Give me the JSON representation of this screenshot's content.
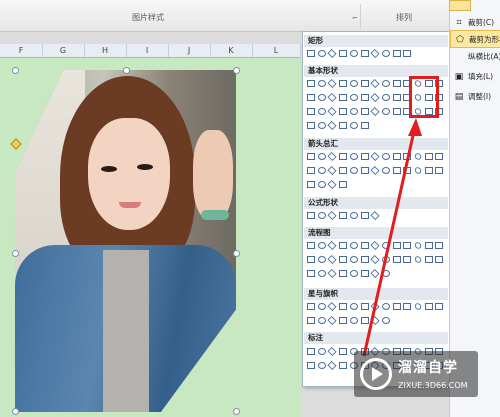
{
  "ribbon": {
    "group_picture_style": "图片样式",
    "group_arrange": "排列",
    "launcher": "⌐"
  },
  "columns": [
    "F",
    "G",
    "H",
    "I",
    "J",
    "K",
    "L"
  ],
  "shapes_panel": {
    "sections": [
      "矩形",
      "基本形状",
      "箭头总汇",
      "公式形状",
      "流程图",
      "星与旗帜",
      "标注"
    ]
  },
  "context_menu": {
    "items": [
      {
        "icon": "crop-icon",
        "label": "裁剪(C)",
        "selected": false
      },
      {
        "icon": "crop-to-shape-icon",
        "label": "裁剪为形状",
        "selected": true
      },
      {
        "icon": "aspect-ratio-icon",
        "label": "纵横比(A)",
        "selected": false
      },
      {
        "icon": "fill-icon",
        "label": "填充(L)",
        "selected": false
      },
      {
        "icon": "fit-icon",
        "label": "调整(I)",
        "selected": false
      }
    ]
  },
  "watermark": {
    "brand": "溜溜自学",
    "site": "ZIXUE.3D66.COM"
  },
  "colors": {
    "sheet_green": "#c7e8c0",
    "highlight_red": "#e21d1d",
    "menu_selected": "#fde8a0"
  }
}
